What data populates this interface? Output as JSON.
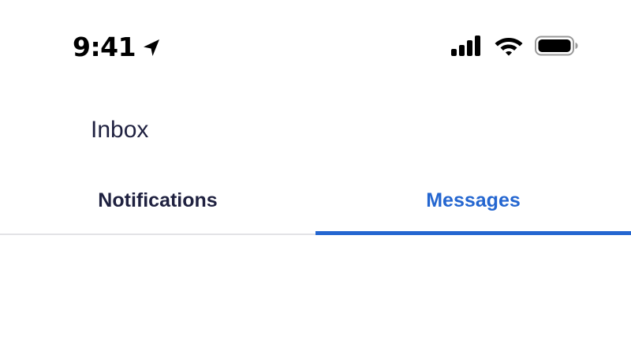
{
  "status_bar": {
    "time": "9:41",
    "icons": [
      "location-arrow-icon",
      "cellular-signal-icon",
      "wifi-icon",
      "battery-icon"
    ]
  },
  "header": {
    "title": "Inbox"
  },
  "tabs": [
    {
      "label": "Notifications",
      "selected": false
    },
    {
      "label": "Messages",
      "selected": true
    }
  ],
  "colors": {
    "accent": "#2466d0",
    "text_dark": "#1f2140",
    "divider": "#e3e3e6",
    "background": "#ffffff"
  }
}
